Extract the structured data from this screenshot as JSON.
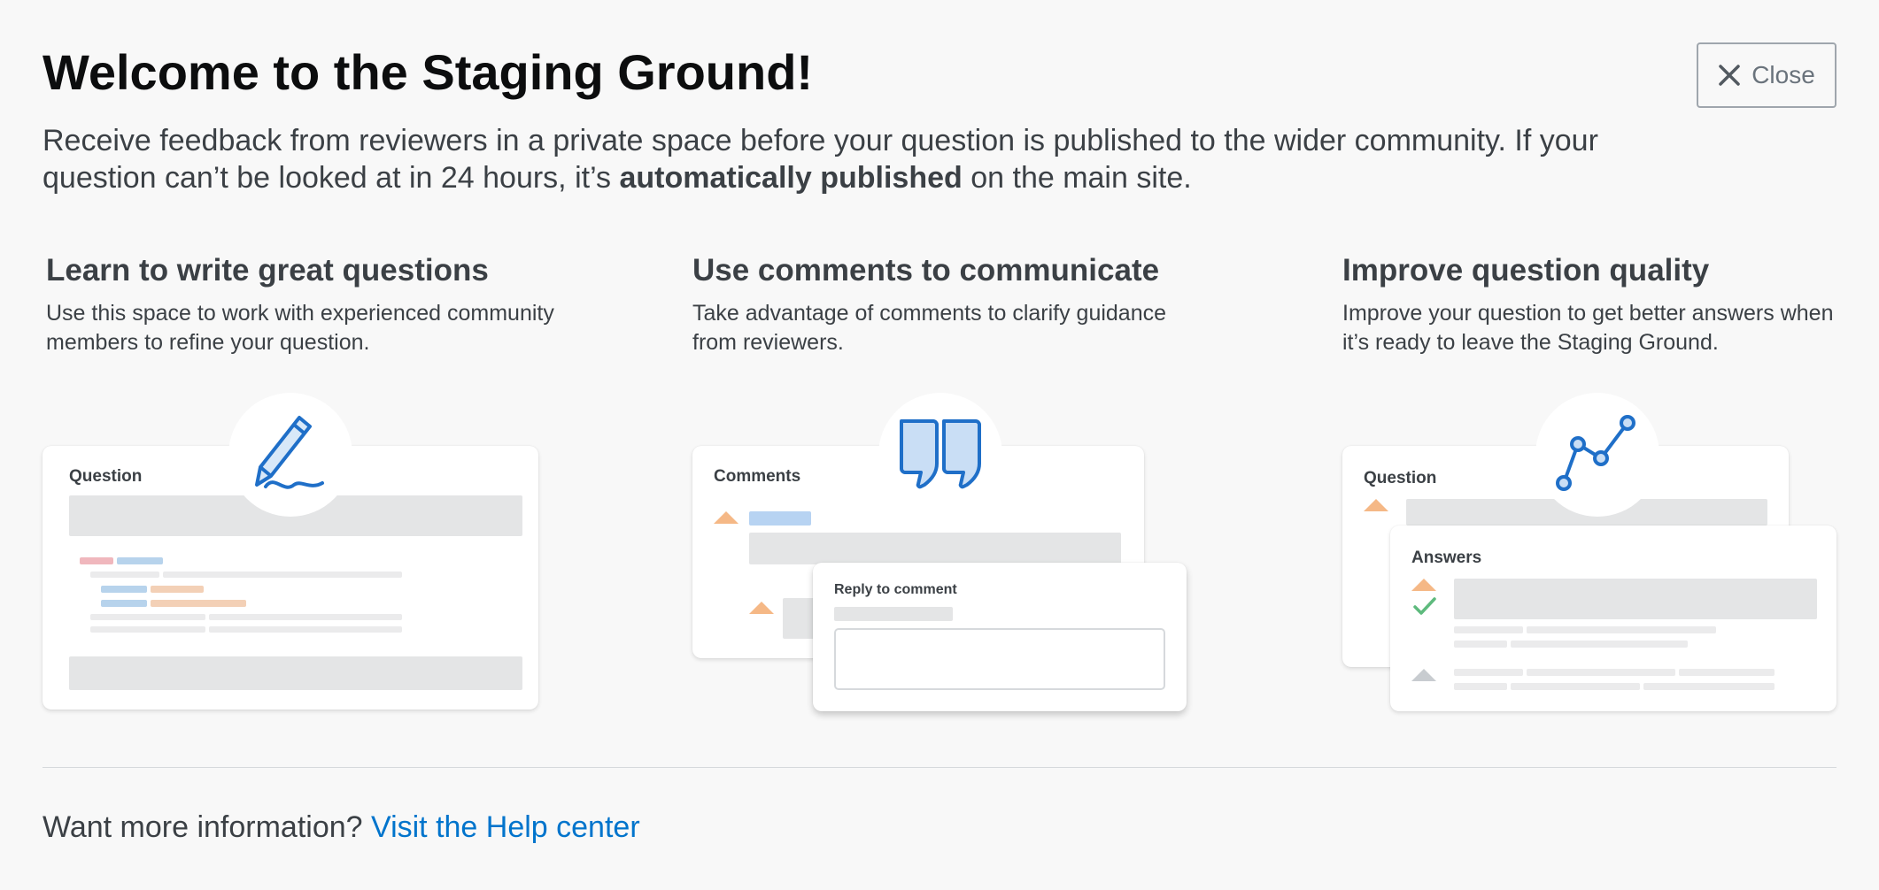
{
  "header": {
    "title": "Welcome to the Staging Ground!",
    "close_label": "Close",
    "intro_part1": "Receive feedback from reviewers in a private space before your question is published to the wider community. If your question can’t be looked at in 24 hours, it’s ",
    "intro_bold": "automatically published",
    "intro_part2": " on the main site."
  },
  "columns": [
    {
      "title": "Learn to write great questions",
      "description": "Use this space to work with experienced community members to refine your question.",
      "card_label": "Question",
      "icon": "pencil-icon"
    },
    {
      "title": "Use comments to communicate",
      "description": "Take advantage of comments to clarify guidance from reviewers.",
      "card_label": "Comments",
      "reply_label": "Reply to comment",
      "icon": "quote-icon"
    },
    {
      "title": "Improve question quality",
      "description": "Improve your question to get better answers when it’s ready to leave the Staging Ground.",
      "card_label": "Question",
      "answers_label": "Answers",
      "icon": "line-chart-icon"
    }
  ],
  "footer": {
    "prompt": "Want more information? ",
    "link_label": "Visit the Help center"
  },
  "colors": {
    "accent": "#0074cc",
    "vote": "#f5b886",
    "check": "#5eba7d"
  }
}
